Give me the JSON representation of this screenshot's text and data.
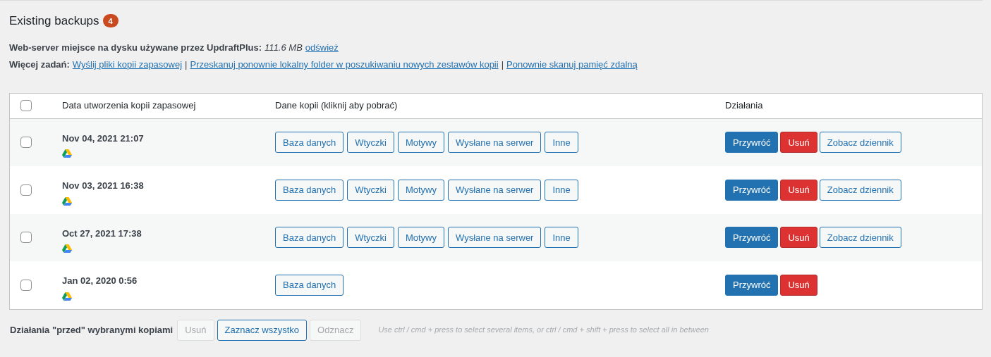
{
  "heading": {
    "title": "Existing backups",
    "count": "4"
  },
  "disk_usage": {
    "label": "Web-server miejsce na dysku używane przez UpdraftPlus:",
    "value": "111.6 MB",
    "link": "odśwież"
  },
  "more_tasks": {
    "label": "Więcej zadań:",
    "links": [
      "Wyślij pliki kopii zapasowej",
      "Przeskanuj ponownie lokalny folder w poszukiwaniu nowych zestawów kopii",
      "Ponownie skanuj pamięć zdalną"
    ],
    "separator": "|"
  },
  "table": {
    "columns": [
      "Data utworzenia kopii zapasowej",
      "Dane kopii (kliknij aby pobrać)",
      "Działania"
    ],
    "select_all_checked": false,
    "rows": [
      {
        "date": "Nov 04, 2021 21:07",
        "checked": false,
        "data": [
          "Baza danych",
          "Wtyczki",
          "Motywy",
          "Wysłane na serwer",
          "Inne"
        ],
        "actions": [
          {
            "kind": "restore",
            "label": "Przywróć"
          },
          {
            "kind": "delete",
            "label": "Usuń"
          },
          {
            "kind": "log",
            "label": "Zobacz dziennik"
          }
        ]
      },
      {
        "date": "Nov 03, 2021 16:38",
        "checked": false,
        "data": [
          "Baza danych",
          "Wtyczki",
          "Motywy",
          "Wysłane na serwer",
          "Inne"
        ],
        "actions": [
          {
            "kind": "restore",
            "label": "Przywróć"
          },
          {
            "kind": "delete",
            "label": "Usuń"
          },
          {
            "kind": "log",
            "label": "Zobacz dziennik"
          }
        ]
      },
      {
        "date": "Oct 27, 2021 17:38",
        "checked": false,
        "data": [
          "Baza danych",
          "Wtyczki",
          "Motywy",
          "Wysłane na serwer",
          "Inne"
        ],
        "actions": [
          {
            "kind": "restore",
            "label": "Przywróć"
          },
          {
            "kind": "delete",
            "label": "Usuń"
          },
          {
            "kind": "log",
            "label": "Zobacz dziennik"
          }
        ]
      },
      {
        "date": "Jan 02, 2020 0:56",
        "checked": false,
        "data": [
          "Baza danych"
        ],
        "actions": [
          {
            "kind": "restore",
            "label": "Przywróć"
          },
          {
            "kind": "delete",
            "label": "Usuń"
          }
        ]
      }
    ]
  },
  "bulk": {
    "label": "Działania \"przed\" wybranymi kopiami",
    "buttons": [
      {
        "label": "Usuń",
        "disabled": true
      },
      {
        "label": "Zaznacz wszystko",
        "disabled": false
      },
      {
        "label": "Odznacz",
        "disabled": true
      }
    ],
    "hint": "Use ctrl / cmd + press to select several items, or ctrl / cmd + shift + press to select all in between"
  }
}
